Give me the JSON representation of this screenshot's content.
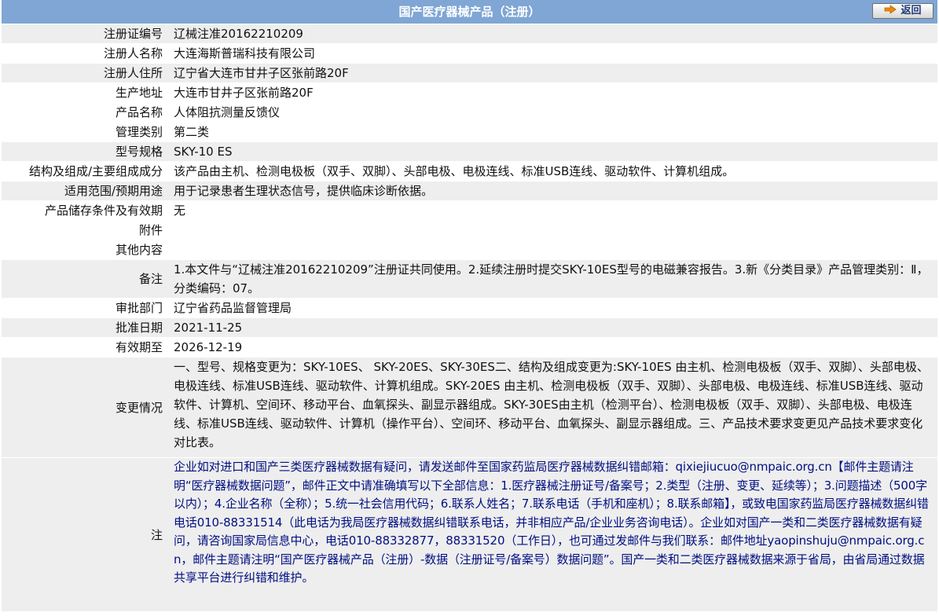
{
  "header": {
    "title": "国产医疗器械产品（注册）",
    "back_label": "返回",
    "back_icon": "arrow-right-icon",
    "accent": "#7fa6d4"
  },
  "rows": [
    {
      "label": "注册证编号",
      "value": "辽械注准20162210209"
    },
    {
      "label": "注册人名称",
      "value": "大连海斯普瑞科技有限公司"
    },
    {
      "label": "注册人住所",
      "value": "辽宁省大连市甘井子区张前路20F"
    },
    {
      "label": "生产地址",
      "value": "大连市甘井子区张前路20F"
    },
    {
      "label": "产品名称",
      "value": "人体阻抗测量反馈仪"
    },
    {
      "label": "管理类别",
      "value": "第二类"
    },
    {
      "label": "型号规格",
      "value": "SKY-10 ES"
    },
    {
      "label": "结构及组成/主要组成成分",
      "value": "该产品由主机、检测电极板（双手、双脚）、头部电极、电极连线、标准USB连线、驱动软件、计算机组成。"
    },
    {
      "label": "适用范围/预期用途",
      "value": "用于记录患者生理状态信号，提供临床诊断依据。"
    },
    {
      "label": "产品储存条件及有效期",
      "value": "无"
    },
    {
      "label": "附件",
      "value": ""
    },
    {
      "label": "其他内容",
      "value": ""
    },
    {
      "label": "备注",
      "value": "1.本文件与“辽械注准20162210209”注册证共同使用。2.延续注册时提交SKY-10ES型号的电磁兼容报告。3.新《分类目录》产品管理类别：Ⅱ，分类编码：07。"
    },
    {
      "label": "审批部门",
      "value": "辽宁省药品监督管理局"
    },
    {
      "label": "批准日期",
      "value": "2021-11-25"
    },
    {
      "label": "有效期至",
      "value": "2026-12-19"
    },
    {
      "label": "变更情况",
      "value": "一、型号、规格变更为：SKY-10ES、 SKY-20ES、SKY-30ES二、结构及组成变更为:SKY-10ES 由主机、检测电极板（双手、双脚）、头部电极、电极连线、标准USB连线、驱动软件、计算机组成。SKY-20ES 由主机、检测电极板（双手、双脚）、头部电极、电极连线、标准USB连线、驱动软件、计算机、空间环、移动平台、血氧探头、副显示器组成。SKY-30ES由主机（检测平台）、检测电极板（双手、双脚）、头部电极、电极连线、标准USB连线、驱动软件、计算机（操作平台）、空间环、移动平台、血氧探头、副显示器组成。三、产品技术要求变更见产品技术要求变化对比表。"
    },
    {
      "label": "注",
      "value": "企业如对进口和国产三类医疗器械数据有疑问，请发送邮件至国家药监局医疗器械数据纠错邮箱：qixiejiucuo@nmpaic.org.cn【邮件主题请注明“医疗器械数据问题”，邮件正文中请准确填写以下全部信息：1.医疗器械注册证号/备案号；2.类型（注册、变更、延续等）；3.问题描述（500字以内）；4.企业名称（全称）；5.统一社会信用代码；6.联系人姓名；7.联系电话（手机和座机）；8.联系邮箱】，或致电国家药监局医疗器械数据纠错电话010-88331514（此电话为我局医疗器械数据纠错联系电话，并非相应产品/企业业务咨询电话）。企业如对国产一类和二类医疗器械数据有疑问，请咨询国家局信息中心，电话010-88332877，88331520（工作日），也可通过发邮件与我们联系：邮件地址yaopinshuju@nmpaic.org.cn，邮件主题请注明“国产医疗器械产品（注册）-数据（注册证号/备案号）数据问题”。国产一类和二类医疗器械数据来源于省局，由省局通过数据共享平台进行纠错和维护。"
    }
  ]
}
